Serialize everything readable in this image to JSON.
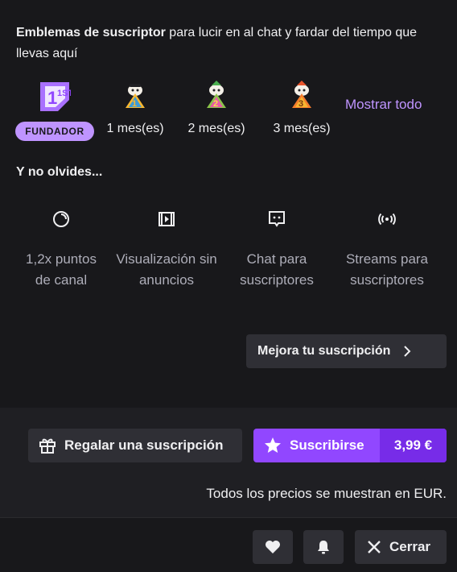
{
  "header": {
    "title_bold": "Emblemas de suscriptor",
    "title_rest": " para lucir en al chat y fardar del tiempo que llevas aquí"
  },
  "badges": [
    {
      "label": "FUNDADOR",
      "icon": "founder-1st-badge-icon",
      "type": "pill"
    },
    {
      "label": "1 mes(es)",
      "icon": "month-1-badge-icon",
      "number": "1"
    },
    {
      "label": "2 mes(es)",
      "icon": "month-2-badge-icon",
      "number": "2"
    },
    {
      "label": "3 mes(es)",
      "icon": "month-3-badge-icon",
      "number": "3"
    }
  ],
  "founder_badge_text": "1ST",
  "show_all": "Mostrar todo",
  "perks_heading": "Y no olvides...",
  "perks": [
    {
      "line1": "1,2x puntos",
      "line2": "de canal",
      "icon": "channel-points-icon"
    },
    {
      "line1": "Visualización sin",
      "line2": "anuncios",
      "icon": "ad-free-icon"
    },
    {
      "line1": "Chat para",
      "line2": "suscriptores",
      "icon": "sub-chat-icon"
    },
    {
      "line1": "Streams para",
      "line2": "suscriptores",
      "icon": "sub-streams-icon"
    }
  ],
  "upgrade_button": "Mejora tu suscripción",
  "gift_button": "Regalar una suscripción",
  "subscribe_button": "Suscribirse",
  "price": "3,99 €",
  "price_note": "Todos los precios se muestran en EUR.",
  "close_button": "Cerrar",
  "colors": {
    "accent": "#9147ff",
    "accent_dark": "#772ce8",
    "link": "#bf94ff",
    "background": "#18181b",
    "panel": "#1f1f23",
    "button": "#2f2f35"
  }
}
